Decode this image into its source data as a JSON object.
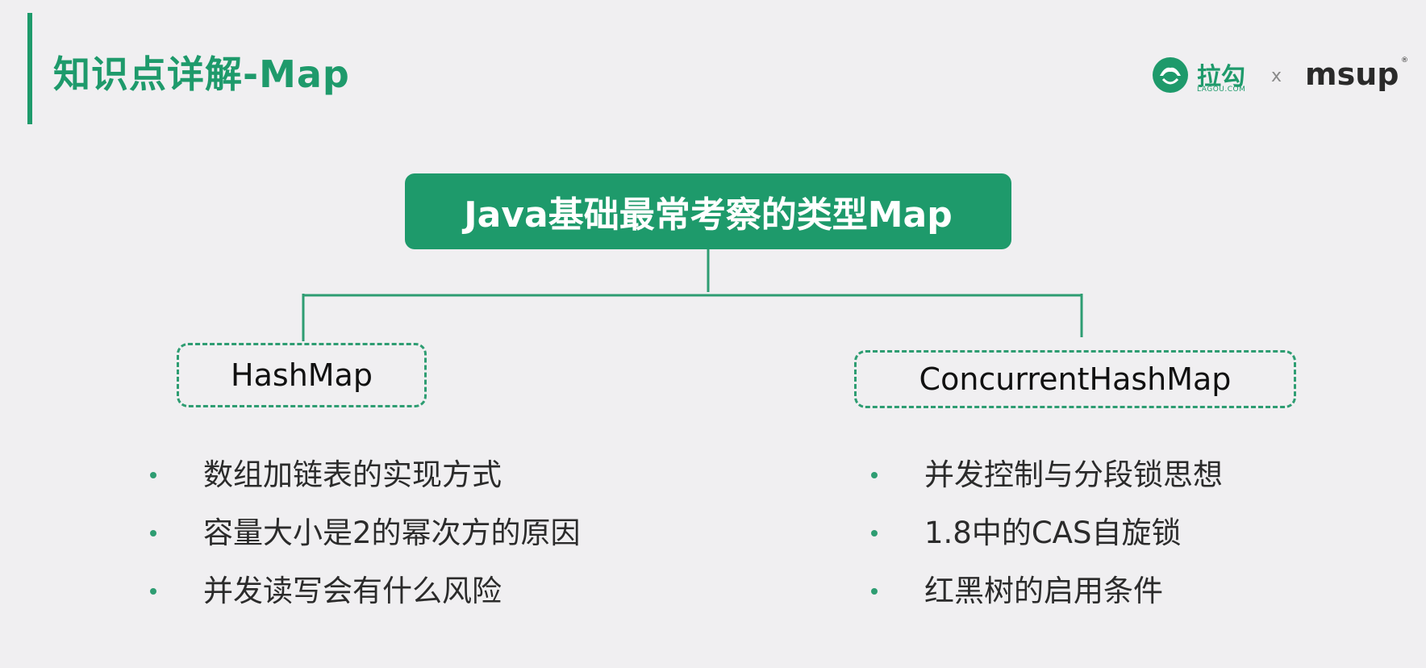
{
  "header": {
    "title": "知识点详解-Map"
  },
  "brand": {
    "lagou_cn": "拉勾",
    "lagou_en": "LAGOU.COM",
    "separator": "x",
    "msup": "msup",
    "registered": "®",
    "accent_color": "#1e9a6b"
  },
  "diagram": {
    "root": "Java基础最常考察的类型Map",
    "children": [
      {
        "label": "HashMap",
        "points": [
          "数组加链表的实现方式",
          "容量大小是2的幂次方的原因",
          "并发读写会有什么风险"
        ]
      },
      {
        "label": "ConcurrentHashMap",
        "points": [
          "并发控制与分段锁思想",
          "1.8中的CAS自旋锁",
          "红黑树的启用条件"
        ]
      }
    ]
  }
}
